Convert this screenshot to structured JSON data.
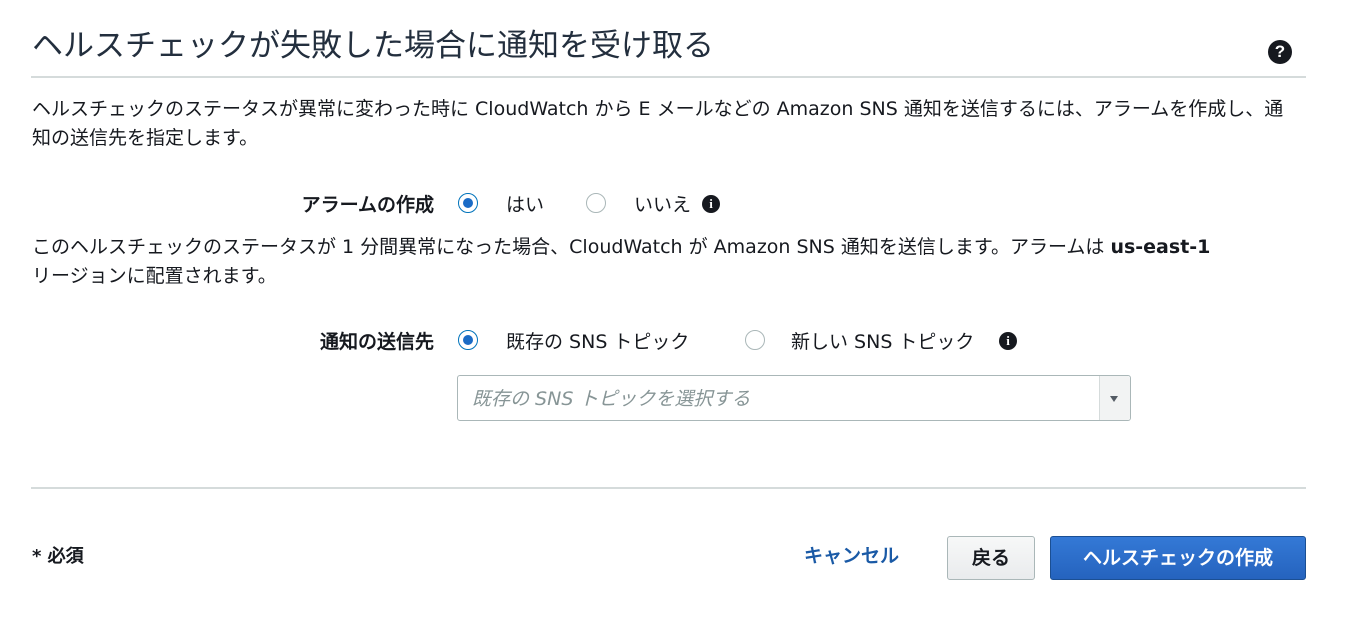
{
  "header": {
    "title": "ヘルスチェックが失敗した場合に通知を受け取る",
    "help_icon": "question-circle-icon",
    "help_glyph": "?"
  },
  "description": "ヘルスチェックのステータスが異常に変わった時に CloudWatch から E メールなどの Amazon SNS 通知を送信するには、アラームを作成し、通知の送信先を指定します。",
  "alarm": {
    "label": "アラームの作成",
    "options": [
      {
        "label": "はい",
        "checked": true
      },
      {
        "label": "いいえ",
        "checked": false
      }
    ],
    "info_icon": "info-circle-icon",
    "info_glyph": "i"
  },
  "alarm_description": {
    "before": "このヘルスチェックのステータスが 1 分間異常になった場合、CloudWatch が Amazon SNS 通知を送信します。アラームは ",
    "region": "us-east-1",
    "after": " リージョンに配置されます。"
  },
  "destination": {
    "label": "通知の送信先",
    "options": [
      {
        "label": "既存の SNS トピック",
        "checked": true
      },
      {
        "label": "新しい SNS トピック",
        "checked": false
      }
    ],
    "info_icon": "info-circle-icon",
    "info_glyph": "i",
    "select_placeholder": "既存の SNS トピックを選択する"
  },
  "footer": {
    "required_note": "* 必須",
    "cancel_label": "キャンセル",
    "back_label": "戻る",
    "create_label": "ヘルスチェックの作成"
  },
  "colors": {
    "primary_button": "#2a6bc8",
    "link": "#1a5aa6",
    "radio_checked": "#1a6bc6",
    "divider": "#d5dbdb"
  }
}
